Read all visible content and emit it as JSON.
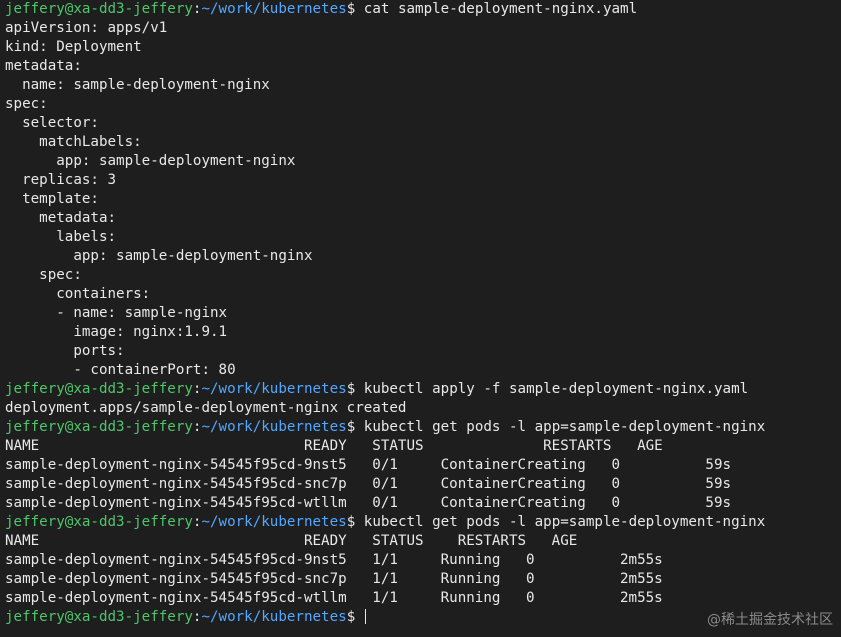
{
  "prompt": {
    "user_host": "jeffery@xa-dd3-jeffery",
    "separator": ":",
    "path": "~/work/kubernetes",
    "symbol": "$ "
  },
  "lines": [
    {
      "type": "prompt",
      "command": "cat sample-deployment-nginx.yaml"
    },
    {
      "type": "output",
      "text": "apiVersion: apps/v1"
    },
    {
      "type": "output",
      "text": "kind: Deployment"
    },
    {
      "type": "output",
      "text": "metadata:"
    },
    {
      "type": "output",
      "text": "  name: sample-deployment-nginx"
    },
    {
      "type": "output",
      "text": "spec:"
    },
    {
      "type": "output",
      "text": "  selector:"
    },
    {
      "type": "output",
      "text": "    matchLabels:"
    },
    {
      "type": "output",
      "text": "      app: sample-deployment-nginx"
    },
    {
      "type": "output",
      "text": "  replicas: 3"
    },
    {
      "type": "output",
      "text": "  template:"
    },
    {
      "type": "output",
      "text": "    metadata:"
    },
    {
      "type": "output",
      "text": "      labels:"
    },
    {
      "type": "output",
      "text": "        app: sample-deployment-nginx"
    },
    {
      "type": "output",
      "text": "    spec:"
    },
    {
      "type": "output",
      "text": "      containers:"
    },
    {
      "type": "output",
      "text": "      - name: sample-nginx"
    },
    {
      "type": "output",
      "text": "        image: nginx:1.9.1"
    },
    {
      "type": "output",
      "text": "        ports:"
    },
    {
      "type": "output",
      "text": "        - containerPort: 80"
    },
    {
      "type": "prompt",
      "command": "kubectl apply -f sample-deployment-nginx.yaml"
    },
    {
      "type": "output",
      "text": "deployment.apps/sample-deployment-nginx created"
    },
    {
      "type": "prompt",
      "command": "kubectl get pods -l app=sample-deployment-nginx"
    },
    {
      "type": "output",
      "text": "NAME                               READY   STATUS              RESTARTS   AGE"
    },
    {
      "type": "output",
      "text": "sample-deployment-nginx-54545f95cd-9nst5   0/1     ContainerCreating   0          59s"
    },
    {
      "type": "output",
      "text": "sample-deployment-nginx-54545f95cd-snc7p   0/1     ContainerCreating   0          59s"
    },
    {
      "type": "output",
      "text": "sample-deployment-nginx-54545f95cd-wtllm   0/1     ContainerCreating   0          59s"
    },
    {
      "type": "prompt",
      "command": "kubectl get pods -l app=sample-deployment-nginx"
    },
    {
      "type": "output",
      "text": "NAME                               READY   STATUS    RESTARTS   AGE"
    },
    {
      "type": "output",
      "text": "sample-deployment-nginx-54545f95cd-9nst5   1/1     Running   0          2m55s"
    },
    {
      "type": "output",
      "text": "sample-deployment-nginx-54545f95cd-snc7p   1/1     Running   0          2m55s"
    },
    {
      "type": "output",
      "text": "sample-deployment-nginx-54545f95cd-wtllm   1/1     Running   0          2m55s"
    },
    {
      "type": "prompt",
      "command": "",
      "cursor": true
    }
  ],
  "watermark": "@稀土掘金技术社区",
  "colors": {
    "background": "#1e1e1e",
    "text": "#e8e8e8",
    "user_host": "#4ec66a",
    "path": "#52a7ff"
  }
}
